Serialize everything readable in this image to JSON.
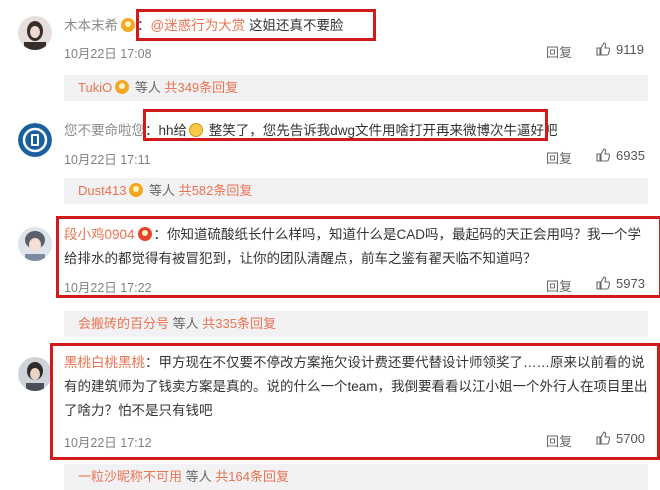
{
  "comments": [
    {
      "user": "木本末希",
      "mention": "@迷惑行为大赏",
      "text": " 这姐还真不要脸",
      "time": "10月22日 17:08",
      "reply_label": "回复",
      "likes": "9119",
      "sub": {
        "user": "TukiO",
        "others": "等人",
        "count": "共349条回复"
      }
    },
    {
      "user": "您不要命啦您",
      "text": "hh给",
      "text_after": " 整笑了，您先告诉我dwg文件用啥打开再来微博次牛逼好吧",
      "time": "10月22日 17:11",
      "reply_label": "回复",
      "likes": "6935",
      "sub": {
        "user": "Dust413",
        "others": "等人",
        "count": "共582条回复"
      }
    },
    {
      "user": "段小鸡0904",
      "line1": "：你知道硫酸纸长什么样吗，知道什么是CAD吗，最起码的天正会用吗？我一个学",
      "line2": "给排水的都觉得有被冒犯到，让你的团队清醒点，前车之鉴有翟天临不知道吗？",
      "time": "10月22日 17:22",
      "reply_label": "回复",
      "likes": "5973",
      "sub": {
        "user": "会搬砖的百分号",
        "others": "等人",
        "count": "共335条回复"
      }
    },
    {
      "user": "黑桃白桃黑桃",
      "line1": "：甲方现在不仅要不停改方案拖欠设计费还要代替设计师领奖了……原来以前看的说",
      "line2": "有的建筑师为了钱卖方案是真的。说的什么一个team，我倒要看看以江小姐一个外行人在项目里出",
      "line3": "了啥力？怕不是只有钱吧",
      "time": "10月22日 17:12",
      "reply_label": "回复",
      "likes": "5700",
      "sub": {
        "user": "一粒沙昵称不可用",
        "others": "等人",
        "count": "共164条回复"
      }
    }
  ],
  "colors": {
    "highlight": "#d31a1a",
    "username": "#eb7350",
    "sub_bg": "#f2f2f5"
  }
}
